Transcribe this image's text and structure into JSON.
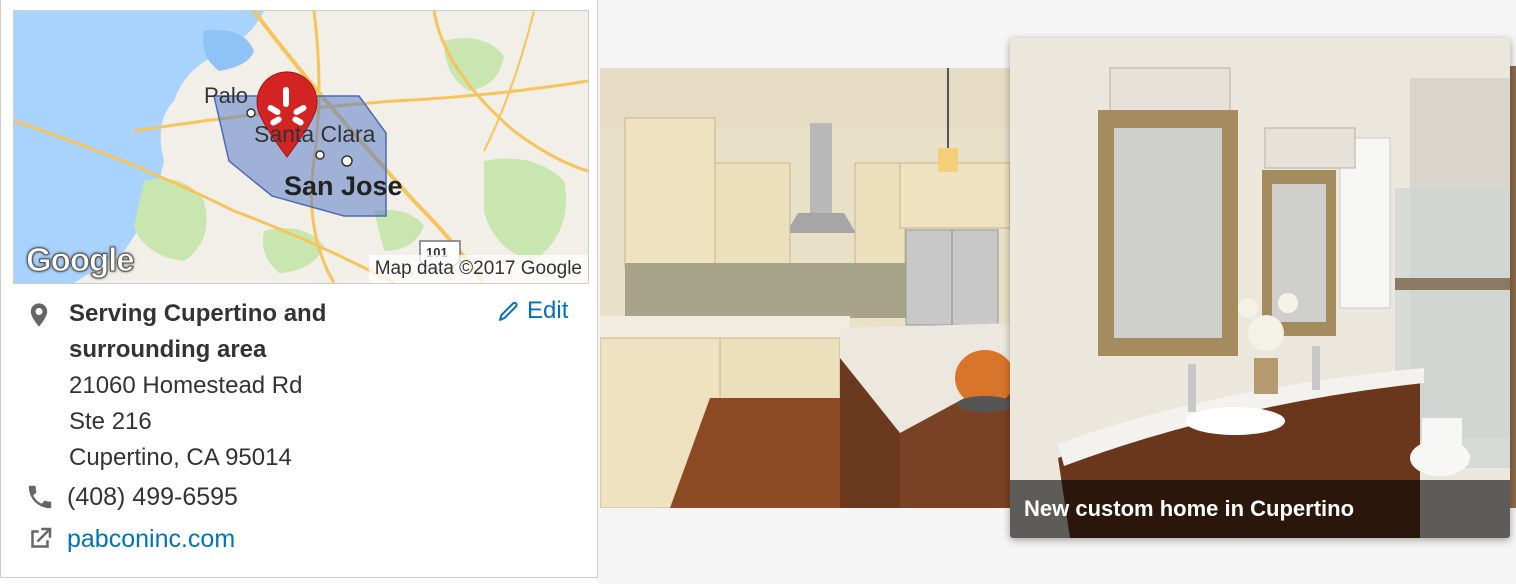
{
  "map": {
    "labels": {
      "palo": "Palo",
      "santa_clara": "Santa Clara",
      "san_jose": "San Jose",
      "highway": "101"
    },
    "attribution": "Map data ©2017 Google",
    "logo": "Google",
    "marker_icon": "yelp-burst-icon",
    "colors": {
      "water": "#a9d3ff",
      "land": "#f2efe9",
      "park": "#c9e5b0",
      "road": "#f7c45b",
      "service_area": "#5b7ec9",
      "marker": "#d32323"
    }
  },
  "business": {
    "service_area": "Serving Cupertino and surrounding area",
    "address_line1": "21060 Homestead Rd",
    "address_line2": "Ste 216",
    "city_line": "Cupertino, CA 95014",
    "edit_label": "Edit",
    "phone": "(408) 499-6595",
    "website": "pabconinc.com",
    "link_color": "#0073bb"
  },
  "gallery": {
    "photos": [
      {
        "subject": "kitchen-photo"
      },
      {
        "subject": "bathroom-photo",
        "caption": "New custom home in Cupertino"
      }
    ]
  }
}
